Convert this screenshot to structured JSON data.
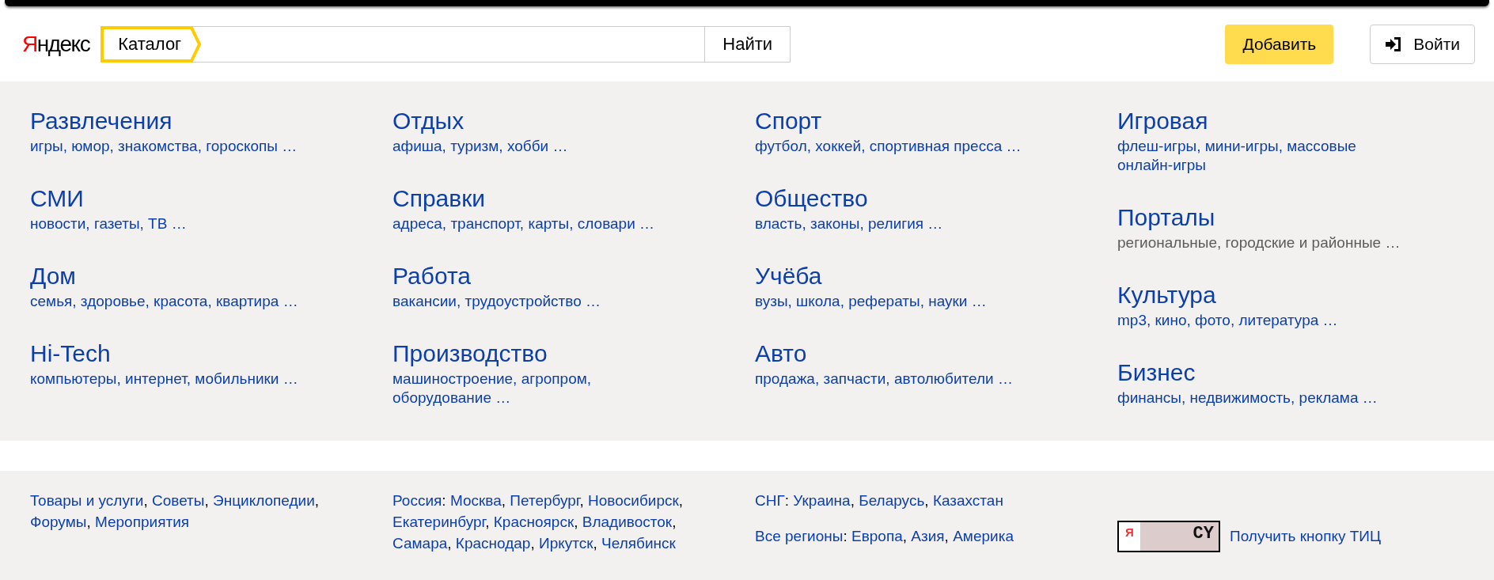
{
  "header": {
    "logo": "Яндекс",
    "search": {
      "tag": "Каталог",
      "button": "Найти"
    },
    "add_button": "Добавить",
    "login_button": "Войти"
  },
  "categories": [
    [
      {
        "title": "Развлечения",
        "subtitle": "игры, юмор, знакомства, гороскопы …",
        "muted": false
      },
      {
        "title": "СМИ",
        "subtitle": "новости, газеты, ТВ …",
        "muted": false
      },
      {
        "title": "Дом",
        "subtitle": "семья, здоровье, красота, квартира …",
        "muted": false
      },
      {
        "title": "Hi-Tech",
        "subtitle": "компьютеры, интернет, мобильники …",
        "muted": false
      }
    ],
    [
      {
        "title": "Отдых",
        "subtitle": "афиша, туризм, хобби …",
        "muted": false
      },
      {
        "title": "Справки",
        "subtitle": "адреса, транспорт, карты, словари …",
        "muted": false
      },
      {
        "title": "Работа",
        "subtitle": "вакансии, трудоустройство …",
        "muted": false
      },
      {
        "title": "Производство",
        "subtitle": "машиностроение, агропром, оборудование …",
        "muted": false
      }
    ],
    [
      {
        "title": "Спорт",
        "subtitle": "футбол, хоккей, спортивная пресса …",
        "muted": false
      },
      {
        "title": "Общество",
        "subtitle": "власть, законы, религия …",
        "muted": false
      },
      {
        "title": "Учёба",
        "subtitle": "вузы, школа, рефераты, науки …",
        "muted": false
      },
      {
        "title": "Авто",
        "subtitle": "продажа, запчасти, автолюбители …",
        "muted": false
      }
    ],
    [
      {
        "title": "Игровая",
        "subtitle": "флеш-игры, мини-игры, массовые онлайн-игры",
        "muted": false
      },
      {
        "title": "Порталы",
        "subtitle": "региональные, городские и районные …",
        "muted": true
      },
      {
        "title": "Культура",
        "subtitle": "mp3, кино, фото, литература …",
        "muted": false
      },
      {
        "title": "Бизнес",
        "subtitle": "финансы, недвижимость, реклама …",
        "muted": false
      }
    ]
  ],
  "footer": {
    "columns": [
      [
        {
          "links": [
            {
              "text": "Товары и услуги",
              "sep": ","
            },
            {
              "text": "Советы",
              "sep": ","
            },
            {
              "text": "Энциклопедии",
              "sep": ","
            },
            {
              "text": "Форумы",
              "sep": ","
            },
            {
              "text": "Мероприятия"
            }
          ]
        }
      ],
      [
        {
          "label": {
            "text": "Россия",
            "sep": ":"
          },
          "links": [
            {
              "text": "Москва",
              "sep": ","
            },
            {
              "text": "Петербург",
              "sep": ","
            },
            {
              "text": "Новосибирск",
              "sep": ","
            },
            {
              "text": "Екатеринбург",
              "sep": ","
            },
            {
              "text": "Красноярск",
              "sep": ","
            },
            {
              "text": "Владивосток",
              "sep": ","
            },
            {
              "text": "Самара",
              "sep": ","
            },
            {
              "text": "Краснодар",
              "sep": ","
            },
            {
              "text": "Иркутск",
              "sep": ","
            },
            {
              "text": "Челябинск"
            }
          ]
        }
      ],
      [
        {
          "label": {
            "text": "СНГ",
            "sep": ":"
          },
          "links": [
            {
              "text": "Украина",
              "sep": ","
            },
            {
              "text": "Беларусь",
              "sep": ","
            },
            {
              "text": "Казахстан"
            }
          ]
        },
        {
          "label": {
            "text": "Все регионы",
            "sep": ":"
          },
          "links": [
            {
              "text": "Европа",
              "sep": ","
            },
            {
              "text": "Азия",
              "sep": ","
            },
            {
              "text": "Америка"
            }
          ]
        }
      ]
    ],
    "badge": {
      "letter": "Я",
      "code": "CY",
      "link": "Получить кнопку ТИЦ"
    }
  }
}
